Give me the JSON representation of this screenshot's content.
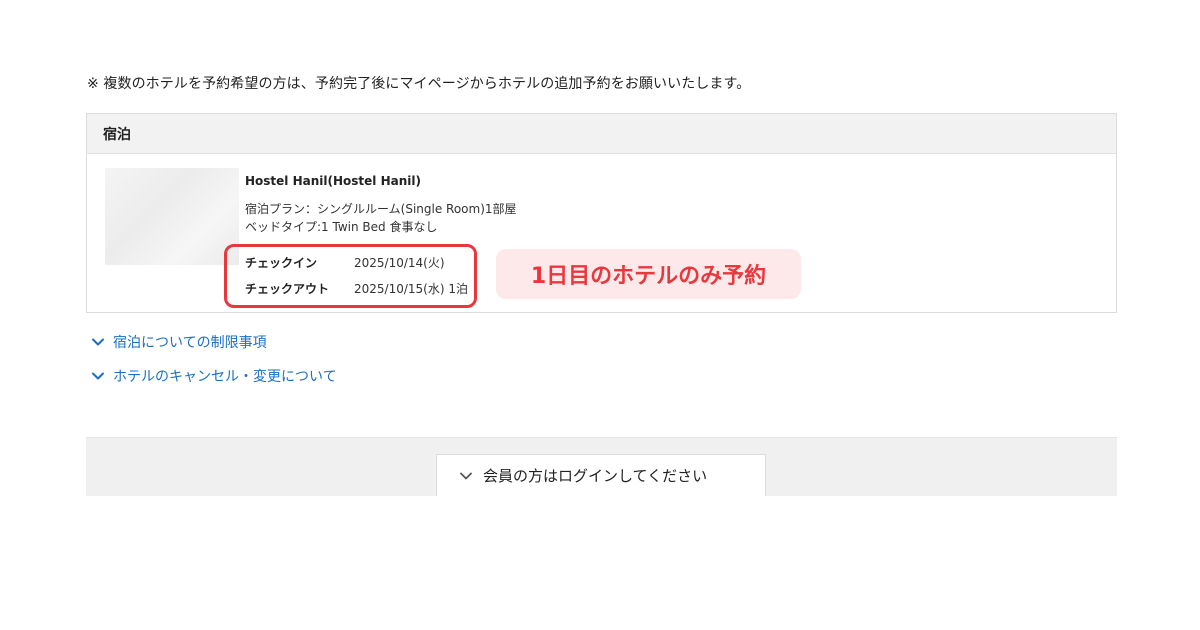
{
  "notice": "※ 複数のホテルを予約希望の方は、予約完了後にマイページからホテルの追加予約をお願いいたします。",
  "lodging": {
    "header": "宿泊",
    "hotel_name": "Hostel Hanil(Hostel Hanil)",
    "plan": "宿泊プラン：シングルルーム(Single Room)1部屋",
    "bed": "ベッドタイプ:1 Twin Bed 食事なし",
    "checkin_label": "チェックイン",
    "checkin_value": "2025/10/14(火)",
    "checkout_label": "チェックアウト",
    "checkout_value": "2025/10/15(水) 1泊"
  },
  "annotation": {
    "callout": "1日目のホテルのみ予約",
    "color": "#e8383d"
  },
  "links": {
    "restrictions": "宿泊についての制限事項",
    "cancel": "ホテルのキャンセル・変更について",
    "color": "#1a6fc4",
    "icon": "chevron-down-icon"
  },
  "member": {
    "login_toggle": "会員の方はログインしてください",
    "icon": "chevron-down-icon"
  }
}
